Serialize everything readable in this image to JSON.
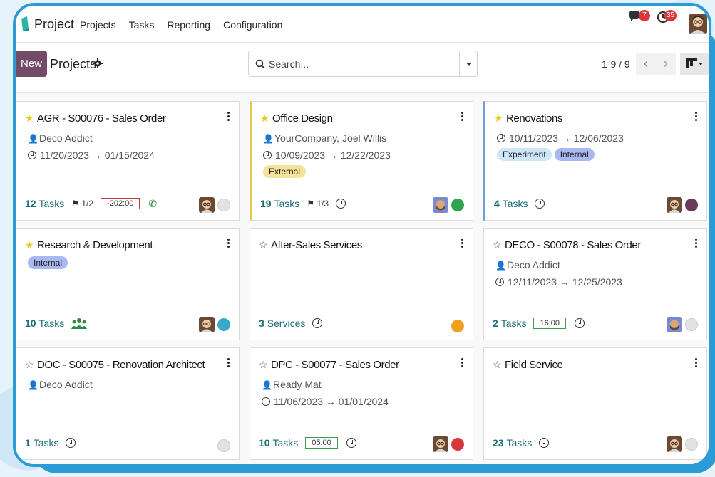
{
  "nav": {
    "brand": "Project",
    "menu": [
      "Projects",
      "Tasks",
      "Reporting",
      "Configuration"
    ],
    "messages_badge": "7",
    "activities_badge": "35"
  },
  "control": {
    "new_label": "New",
    "title": "Projects",
    "search_placeholder": "Search...",
    "pager": "1-9 / 9"
  },
  "cards": [
    {
      "title": "AGR - S00076 - Sales Order",
      "favorite": true,
      "customer": "Deco Addict",
      "dates": "11/20/2023 → 01/15/2024",
      "count": "12",
      "count_label": "Tasks",
      "milestones": "1/2",
      "time": "-202:00",
      "time_state": "red"
    },
    {
      "title": "Office Design",
      "favorite": true,
      "customer": "YourCompany, Joel Willis",
      "dates": "10/09/2023 → 12/22/2023",
      "tags": [
        "External"
      ],
      "count": "19",
      "count_label": "Tasks",
      "milestones": "1/3"
    },
    {
      "title": "Renovations",
      "favorite": true,
      "dates": "10/11/2023 → 12/06/2023",
      "tags": [
        "Experiment",
        "Internal"
      ],
      "count": "4",
      "count_label": "Tasks"
    },
    {
      "title": "Research & Development",
      "favorite": true,
      "tags": [
        "Internal"
      ],
      "count": "10",
      "count_label": "Tasks"
    },
    {
      "title": "After-Sales Services",
      "favorite": false,
      "count": "3",
      "count_label": "Services"
    },
    {
      "title": "DECO - S00078 - Sales Order",
      "favorite": false,
      "customer": "Deco Addict",
      "dates": "12/11/2023 → 12/25/2023",
      "count": "2",
      "count_label": "Tasks",
      "time": "16:00"
    },
    {
      "title": "DOC - S00075 - Renovation Architect",
      "favorite": false,
      "customer": "Deco Addict",
      "count": "1",
      "count_label": "Tasks"
    },
    {
      "title": "DPC - S00077 - Sales Order",
      "favorite": false,
      "customer": "Ready Mat",
      "dates": "11/06/2023 → 01/01/2024",
      "count": "10",
      "count_label": "Tasks",
      "time": "05:00"
    },
    {
      "title": "Field Service",
      "favorite": false,
      "count": "23",
      "count_label": "Tasks"
    }
  ],
  "colors": {
    "primary": "#714b67",
    "link": "#1a6b79",
    "frame": "#2b9bd6",
    "status_green": "#2ea44f",
    "status_red": "#d9363e",
    "status_orange": "#f0a020",
    "status_grey": "#e2e2e2",
    "status_teal": "#3aa8c8",
    "status_purple": "#6a3a5a"
  }
}
